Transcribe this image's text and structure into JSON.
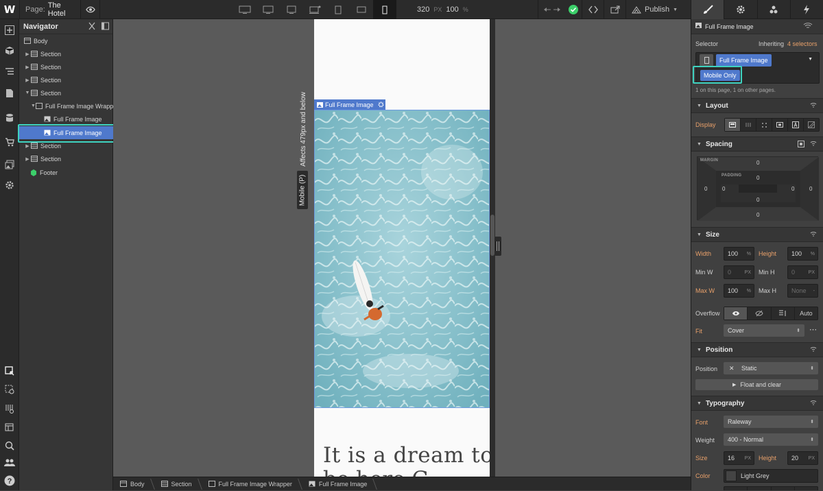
{
  "topbar": {
    "logo": "W",
    "page_label": "Page:",
    "page_name": "The Hotel",
    "width_value": "320",
    "width_unit": "PX",
    "zoom_value": "100",
    "zoom_unit": "%",
    "publish_label": "Publish"
  },
  "navigator": {
    "title": "Navigator",
    "items": [
      {
        "label": "Body"
      },
      {
        "label": "Section"
      },
      {
        "label": "Section"
      },
      {
        "label": "Section"
      },
      {
        "label": "Section"
      },
      {
        "label": "Full Frame Image Wrapper"
      },
      {
        "label": "Full Frame Image"
      },
      {
        "label": "Full Frame Image"
      },
      {
        "label": "Section"
      },
      {
        "label": "Section"
      },
      {
        "label": "Footer"
      }
    ]
  },
  "canvas": {
    "affects_text": "Affects 479px and below",
    "breakpoint_badge": "Mobile (P)",
    "selection_label": "Full Frame Image",
    "heading_line1": "It is a dream to",
    "heading_line2": "be here G"
  },
  "breadcrumb": [
    "Body",
    "Section",
    "Full Frame Image Wrapper",
    "Full Frame Image"
  ],
  "style_panel": {
    "element_name": "Full Frame Image",
    "selector_label": "Selector",
    "inheriting_label": "Inheriting",
    "inheriting_count": "4 selectors",
    "class_primary": "Full Frame Image",
    "class_combo": "Mobile Only",
    "usage_text": "1 on this page, 1 on other pages.",
    "layout": {
      "title": "Layout",
      "display_label": "Display"
    },
    "spacing": {
      "title": "Spacing",
      "margin_label": "MARGIN",
      "padding_label": "PADDING",
      "margin_top": "0",
      "margin_right": "0",
      "margin_bottom": "0",
      "margin_left": "0",
      "padding_top": "0",
      "padding_right": "0",
      "padding_bottom": "0",
      "padding_left": "0"
    },
    "size": {
      "title": "Size",
      "width_label": "Width",
      "width_value": "100",
      "width_unit": "%",
      "height_label": "Height",
      "height_value": "100",
      "height_unit": "%",
      "minw_label": "Min W",
      "minw_value": "0",
      "minw_unit": "PX",
      "minh_label": "Min H",
      "minh_value": "0",
      "minh_unit": "PX",
      "maxw_label": "Max W",
      "maxw_value": "100",
      "maxw_unit": "%",
      "maxh_label": "Max H",
      "maxh_value": "None",
      "maxh_unit": "-",
      "overflow_label": "Overflow",
      "overflow_auto": "Auto",
      "fit_label": "Fit",
      "fit_value": "Cover"
    },
    "position": {
      "title": "Position",
      "position_label": "Position",
      "position_value": "Static",
      "float_label": "Float and clear"
    },
    "typography": {
      "title": "Typography",
      "font_label": "Font",
      "font_value": "Raleway",
      "weight_label": "Weight",
      "weight_value": "400 - Normal",
      "size_label": "Size",
      "size_value": "16",
      "size_unit": "PX",
      "height_label": "Height",
      "height_value": "20",
      "height_unit": "PX",
      "color_label": "Color",
      "color_value": "Light Grey"
    }
  },
  "colors": {
    "accent_blue": "#4f79cc",
    "highlight_teal": "#3ed3c0",
    "label_orange": "#e8a06a",
    "success_green": "#3ccf6a"
  }
}
